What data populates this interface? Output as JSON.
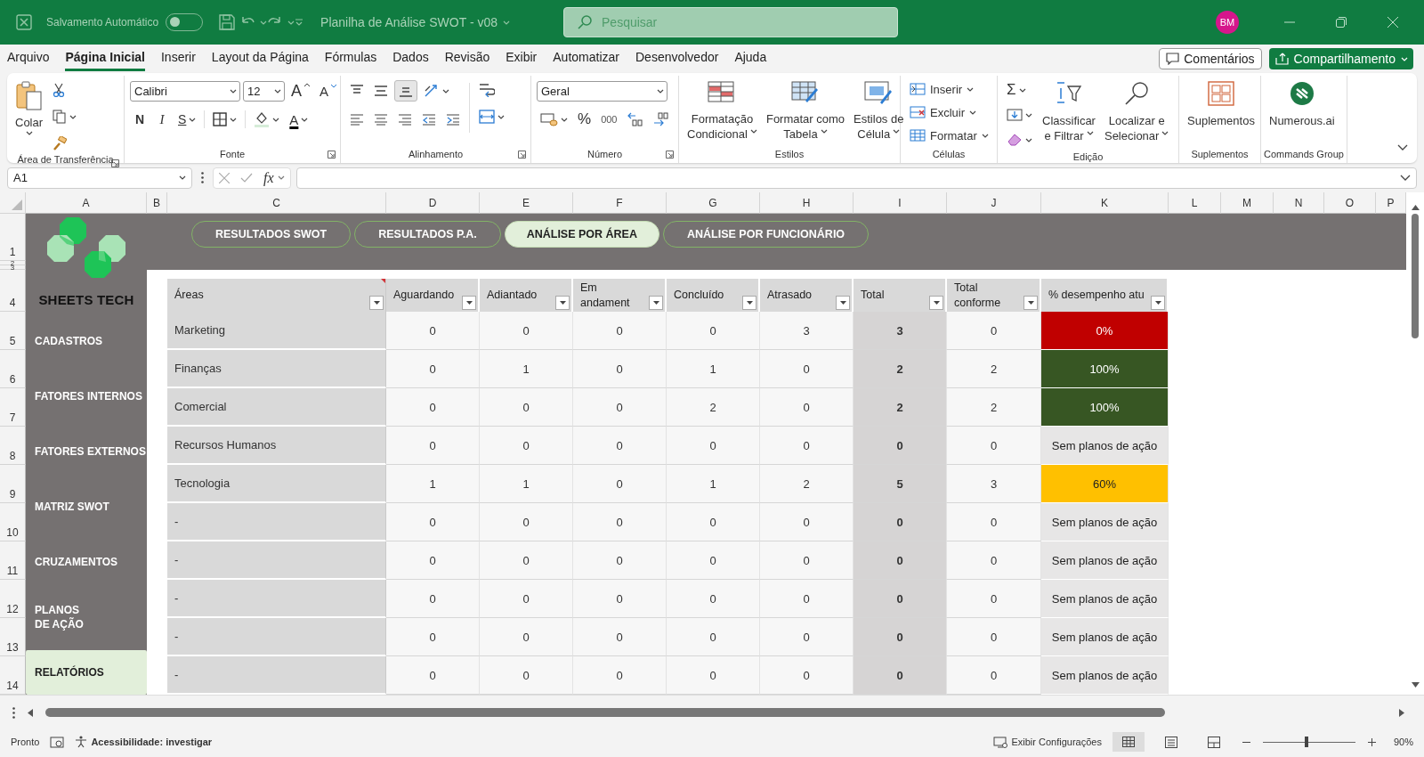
{
  "title_bar": {
    "autosave_label": "Salvamento Automático",
    "autosave_on": false,
    "document_title": "Planilha de Análise SWOT - v08",
    "search_placeholder": "Pesquisar",
    "user_initials": "BM"
  },
  "menu_tabs": [
    {
      "label": "Arquivo",
      "selected": false
    },
    {
      "label": "Página Inicial",
      "selected": true
    },
    {
      "label": "Inserir",
      "selected": false
    },
    {
      "label": "Layout da Página",
      "selected": false
    },
    {
      "label": "Fórmulas",
      "selected": false
    },
    {
      "label": "Dados",
      "selected": false
    },
    {
      "label": "Revisão",
      "selected": false
    },
    {
      "label": "Exibir",
      "selected": false
    },
    {
      "label": "Automatizar",
      "selected": false
    },
    {
      "label": "Desenvolvedor",
      "selected": false
    },
    {
      "label": "Ajuda",
      "selected": false
    }
  ],
  "comments_button": "Comentários",
  "share_button": "Compartilhamento",
  "ribbon": [
    {
      "kind": "clipboard",
      "label": "Área de Transferência",
      "paste": "Colar"
    },
    {
      "kind": "font",
      "label": "Fonte",
      "font": "Calibri",
      "size": "12",
      "grow": "A",
      "shrink": "A",
      "bold": "N",
      "italic": "I",
      "underline": "S",
      "font_color": "A"
    },
    {
      "kind": "alignment",
      "label": "Alinhamento"
    },
    {
      "kind": "number",
      "label": "Número",
      "format": "Geral",
      "percent": "%",
      "thousands": "000"
    },
    {
      "kind": "styles",
      "label": "Estilos",
      "buttons": [
        [
          "Formatação",
          "Condicional"
        ],
        [
          "Formatar como",
          "Tabela"
        ],
        [
          "Estilos de",
          "Célula"
        ]
      ]
    },
    {
      "kind": "cells",
      "label": "Células",
      "buttons": [
        "Inserir",
        "Excluir",
        "Formatar"
      ]
    },
    {
      "kind": "editing",
      "label": "Edição",
      "sum": "Σ",
      "buttons": [
        [
          "Classificar",
          "e Filtrar"
        ],
        [
          "Localizar e",
          "Selecionar"
        ]
      ]
    },
    {
      "kind": "addins",
      "label": "Suplementos",
      "buttons": [
        [
          "Suplementos"
        ]
      ]
    },
    {
      "kind": "commands",
      "label": "Commands Group",
      "buttons": [
        [
          "Numerous.ai"
        ]
      ]
    }
  ],
  "formula_bar": {
    "cell": "A1",
    "fx": "fx"
  },
  "column_headers": [
    "A",
    "B",
    "C",
    "D",
    "E",
    "F",
    "G",
    "H",
    "I",
    "J",
    "K",
    "L",
    "M",
    "N",
    "O",
    "P"
  ],
  "row_headers": [
    "1",
    "2",
    "3",
    "4",
    "5",
    "6",
    "7",
    "8",
    "9",
    "10",
    "11",
    "12",
    "13",
    "14"
  ],
  "logo_text": "SHEETS TECH",
  "report_tabs": [
    {
      "label": "RESULTADOS SWOT",
      "selected": false
    },
    {
      "label": "RESULTADOS P.A.",
      "selected": false
    },
    {
      "label": "ANÁLISE POR ÁREA",
      "selected": true
    },
    {
      "label": "ANÁLISE POR FUNCIONÁRIO",
      "selected": false
    }
  ],
  "sidebar": {
    "items": [
      {
        "label": "CADASTROS",
        "selected": false
      },
      {
        "label": "FATORES INTERNOS",
        "selected": false
      },
      {
        "label": "FATORES EXTERNOS",
        "selected": false
      },
      {
        "label": "MATRIZ SWOT",
        "selected": false
      },
      {
        "label": "CRUZAMENTOS",
        "selected": false
      },
      {
        "label": "PLANOS\nDE AÇÃO",
        "selected": false
      },
      {
        "label": "RELATÓRIOS",
        "selected": true
      }
    ]
  },
  "table": {
    "columns": [
      "Áreas",
      "Aguardando",
      "Adiantado",
      "Em andament",
      "Concluído",
      "Atrasado",
      "Total",
      "Total conforme",
      "% desempenho atu"
    ],
    "rows": [
      {
        "area": "Marketing",
        "counts": [
          "0",
          "0",
          "0",
          "0",
          "3"
        ],
        "total": "3",
        "total_conforme": "0",
        "performance": {
          "text": "0%",
          "color": "#c00000"
        }
      },
      {
        "area": "Finanças",
        "counts": [
          "0",
          "1",
          "0",
          "1",
          "0"
        ],
        "total": "2",
        "total_conforme": "2",
        "performance": {
          "text": "100%",
          "color": "#375623"
        }
      },
      {
        "area": "Comercial",
        "counts": [
          "0",
          "0",
          "0",
          "2",
          "0"
        ],
        "total": "2",
        "total_conforme": "2",
        "performance": {
          "text": "100%",
          "color": "#375623"
        }
      },
      {
        "area": "Recursos Humanos",
        "counts": [
          "0",
          "0",
          "0",
          "0",
          "0"
        ],
        "total": "0",
        "total_conforme": "0",
        "performance": {
          "text": "Sem planos de ação",
          "color": "#e7e6e6"
        }
      },
      {
        "area": "Tecnologia",
        "counts": [
          "1",
          "1",
          "0",
          "1",
          "2"
        ],
        "total": "5",
        "total_conforme": "3",
        "performance": {
          "text": "60%",
          "color": "#ffc000"
        }
      },
      {
        "area": "-",
        "counts": [
          "0",
          "0",
          "0",
          "0",
          "0"
        ],
        "total": "0",
        "total_conforme": "0",
        "performance": {
          "text": "Sem planos de ação",
          "color": "#e7e6e6"
        }
      },
      {
        "area": "-",
        "counts": [
          "0",
          "0",
          "0",
          "0",
          "0"
        ],
        "total": "0",
        "total_conforme": "0",
        "performance": {
          "text": "Sem planos de ação",
          "color": "#e7e6e6"
        }
      },
      {
        "area": "-",
        "counts": [
          "0",
          "0",
          "0",
          "0",
          "0"
        ],
        "total": "0",
        "total_conforme": "0",
        "performance": {
          "text": "Sem planos de ação",
          "color": "#e7e6e6"
        }
      },
      {
        "area": "-",
        "counts": [
          "0",
          "0",
          "0",
          "0",
          "0"
        ],
        "total": "0",
        "total_conforme": "0",
        "performance": {
          "text": "Sem planos de ação",
          "color": "#e7e6e6"
        }
      },
      {
        "area": "-",
        "counts": [
          "0",
          "0",
          "0",
          "0",
          "0"
        ],
        "total": "0",
        "total_conforme": "0",
        "performance": {
          "text": "Sem planos de ação",
          "color": "#e7e6e6"
        }
      }
    ]
  },
  "status_bar": {
    "status": "Pronto",
    "accessibility": "Acessibilidade: investigar",
    "display_settings": "Exibir Configurações",
    "zoom": "90%",
    "zoom_slider": {
      "level": 0.47
    }
  }
}
